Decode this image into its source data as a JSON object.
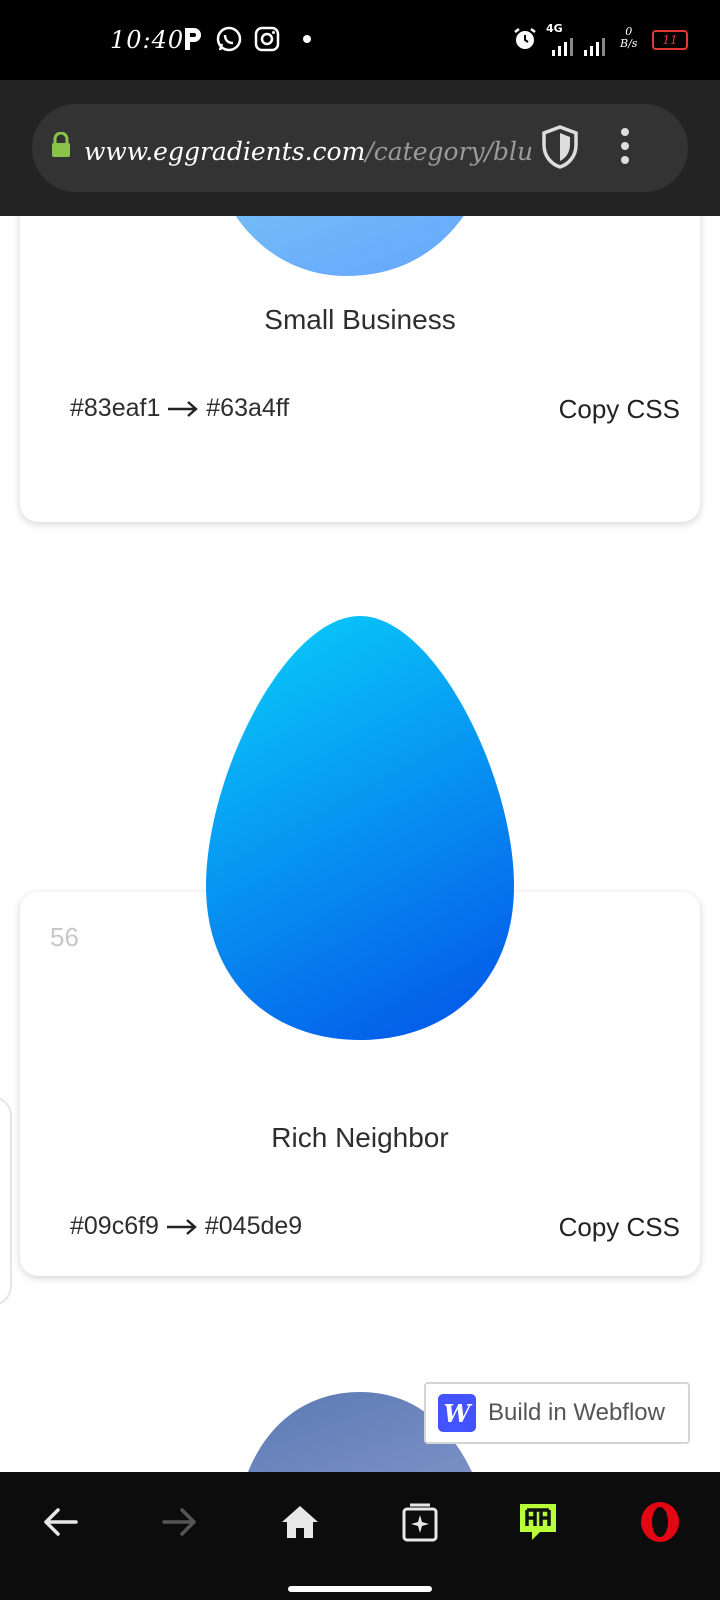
{
  "status_bar": {
    "time": "10:40",
    "network": "4G",
    "data_speed": "0",
    "data_unit": "B/s",
    "battery": "11"
  },
  "browser": {
    "url_domain": "www.eggradients.com",
    "url_path": "/category/blue-g"
  },
  "cards": [
    {
      "title": "Small Business",
      "color_from": "#83eaf1",
      "color_to": "#63a4ff",
      "copy_label": "Copy CSS"
    },
    {
      "number": "56",
      "title": "Rich Neighbor",
      "color_from": "#09c6f9",
      "color_to": "#045de9",
      "copy_label": "Copy CSS"
    }
  ],
  "webflow_badge": {
    "logo": "W",
    "label": "Build in Webflow"
  },
  "colors": {
    "egg_next_from": "#5b7ab5",
    "egg_next_to": "#7a90c4",
    "lock_green": "#8bc34a",
    "battery_red": "#e53935",
    "opera_red": "#e30613",
    "accent_lime": "#b8ff3a"
  },
  "nav_icons": [
    "back-arrow-icon",
    "forward-arrow-icon",
    "home-icon",
    "tabs-icon",
    "hype-icon",
    "opera-icon"
  ]
}
